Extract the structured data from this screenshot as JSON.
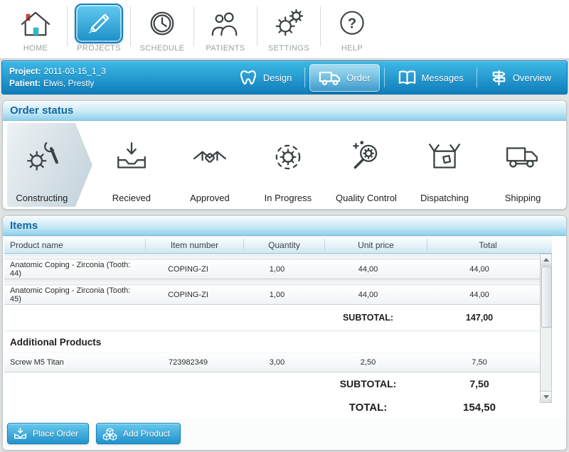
{
  "colors": {
    "accent_blue": "#1f93cc",
    "bar_gradient_top": "#3eb9e6",
    "bar_gradient_bottom": "#0f7dbb",
    "panel_header_text": "#15679f",
    "status_active_bg": "#c2d2da"
  },
  "toolbar": {
    "items": [
      {
        "label": "HOME"
      },
      {
        "label": "PROJECTS"
      },
      {
        "label": "SCHEDULE"
      },
      {
        "label": "PATIENTS"
      },
      {
        "label": "SETTINGS"
      },
      {
        "label": "HELP"
      }
    ]
  },
  "project_bar": {
    "project_label": "Project:",
    "project_value": "2011-03-15_1_3",
    "patient_label": "Patient:",
    "patient_value": "Elwis, Prestly",
    "tabs": [
      {
        "label": "Design"
      },
      {
        "label": "Order"
      },
      {
        "label": "Messages"
      },
      {
        "label": "Overview"
      }
    ]
  },
  "order_status": {
    "title": "Order status",
    "steps": [
      {
        "label": "Constructing"
      },
      {
        "label": "Recieved"
      },
      {
        "label": "Approved"
      },
      {
        "label": "In Progress"
      },
      {
        "label": "Quality Control"
      },
      {
        "label": "Dispatching"
      },
      {
        "label": "Shipping"
      }
    ]
  },
  "items": {
    "title": "Items",
    "columns": [
      "Product name",
      "Item number",
      "Quantity",
      "Unit price",
      "Total"
    ],
    "rows": [
      {
        "product": "Anatomic Coping - Zirconia (Tooth: 44)",
        "item": "COPING-ZI",
        "qty": "1,00",
        "price": "44,00",
        "total": "44,00"
      },
      {
        "product": "Anatomic Coping - Zirconia (Tooth: 45)",
        "item": "COPING-ZI",
        "qty": "1,00",
        "price": "44,00",
        "total": "44,00"
      }
    ],
    "subtotal_label": "SUBTOTAL:",
    "subtotal_value": "147,00",
    "additional_title": "Additional Products",
    "additional_rows": [
      {
        "product": "Screw M5 Titan",
        "item": "723982349",
        "qty": "3,00",
        "price": "2,50",
        "total": "7,50"
      }
    ],
    "additional_subtotal_label": "SUBTOTAL:",
    "additional_subtotal_value": "7,50",
    "total_label": "TOTAL:",
    "total_value": "154,50"
  },
  "actions": {
    "place_order": "Place Order",
    "add_product": "Add Product"
  }
}
